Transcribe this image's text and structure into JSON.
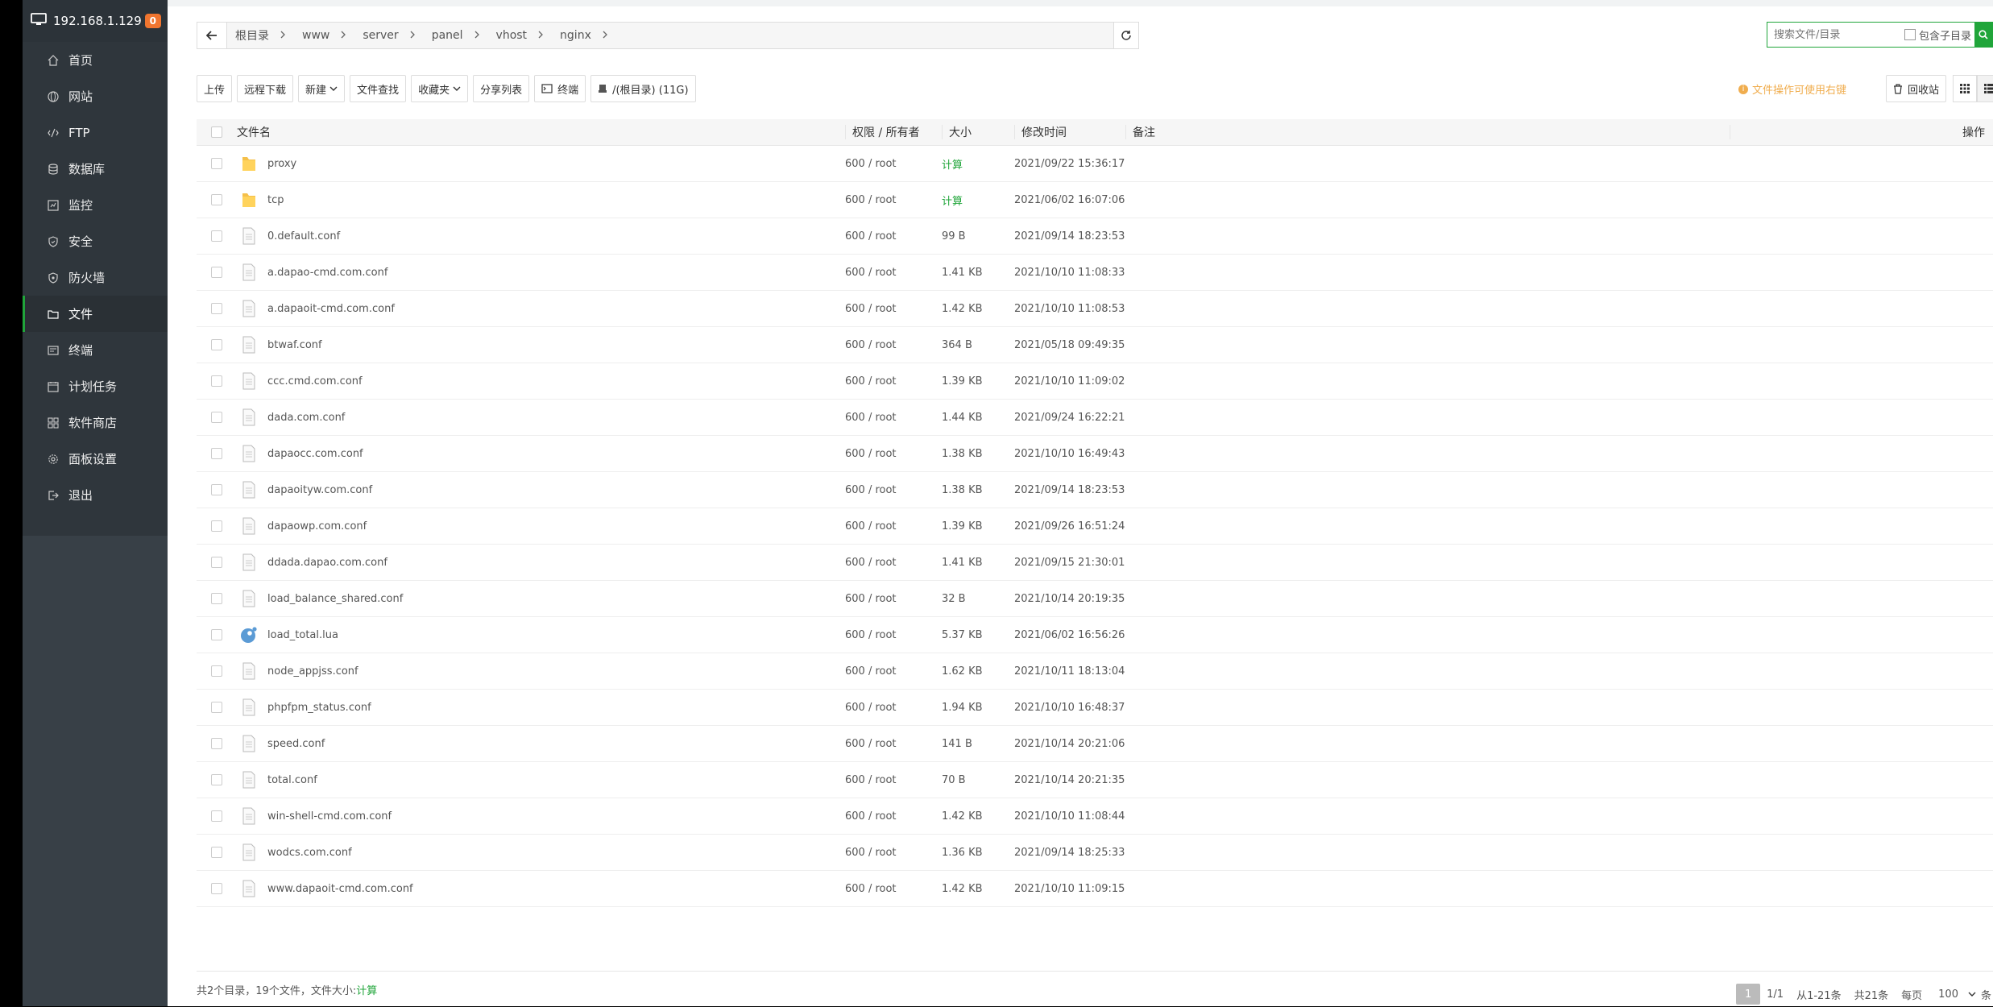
{
  "sidebar": {
    "host": "192.168.1.129",
    "badge": "0",
    "items": [
      {
        "label": "首页",
        "icon": "home-icon"
      },
      {
        "label": "网站",
        "icon": "globe-icon"
      },
      {
        "label": "FTP",
        "icon": "ftp-icon"
      },
      {
        "label": "数据库",
        "icon": "database-icon"
      },
      {
        "label": "监控",
        "icon": "monitor-icon"
      },
      {
        "label": "安全",
        "icon": "shield-icon"
      },
      {
        "label": "防火墙",
        "icon": "firewall-icon"
      },
      {
        "label": "文件",
        "icon": "folder-icon"
      },
      {
        "label": "终端",
        "icon": "terminal-icon"
      },
      {
        "label": "计划任务",
        "icon": "calendar-icon"
      },
      {
        "label": "软件商店",
        "icon": "apps-icon"
      },
      {
        "label": "面板设置",
        "icon": "gear-icon"
      },
      {
        "label": "退出",
        "icon": "logout-icon"
      }
    ],
    "active": "文件"
  },
  "breadcrumb": [
    "根目录",
    "www",
    "server",
    "panel",
    "vhost",
    "nginx"
  ],
  "search": {
    "placeholder": "搜索文件/目录",
    "subdir_label": "包含子目录"
  },
  "toolbar": {
    "upload": "上传",
    "remote_download": "远程下载",
    "new": "新建",
    "file_search": "文件查找",
    "favorites": "收藏夹",
    "share_list": "分享列表",
    "terminal": "终端",
    "disk": "/(根目录) (11G)",
    "tip": "文件操作可使用右键",
    "recycle": "回收站"
  },
  "table": {
    "headers": {
      "name": "文件名",
      "perm": "权限 / 所有者",
      "size": "大小",
      "time": "修改时间",
      "note": "备注",
      "op": "操作"
    },
    "rows": [
      {
        "type": "folder",
        "name": "proxy",
        "perm": "600 / root",
        "size": "计算",
        "time": "2021/09/22 15:36:17"
      },
      {
        "type": "folder",
        "name": "tcp",
        "perm": "600 / root",
        "size": "计算",
        "time": "2021/06/02 16:07:06"
      },
      {
        "type": "file",
        "name": "0.default.conf",
        "perm": "600 / root",
        "size": "99 B",
        "time": "2021/09/14 18:23:53"
      },
      {
        "type": "file",
        "name": "a.dapao-cmd.com.conf",
        "perm": "600 / root",
        "size": "1.41 KB",
        "time": "2021/10/10 11:08:33"
      },
      {
        "type": "file",
        "name": "a.dapaoit-cmd.com.conf",
        "perm": "600 / root",
        "size": "1.42 KB",
        "time": "2021/10/10 11:08:53"
      },
      {
        "type": "file",
        "name": "btwaf.conf",
        "perm": "600 / root",
        "size": "364 B",
        "time": "2021/05/18 09:49:35"
      },
      {
        "type": "file",
        "name": "ccc.cmd.com.conf",
        "perm": "600 / root",
        "size": "1.39 KB",
        "time": "2021/10/10 11:09:02"
      },
      {
        "type": "file",
        "name": "dada.com.conf",
        "perm": "600 / root",
        "size": "1.44 KB",
        "time": "2021/09/24 16:22:21"
      },
      {
        "type": "file",
        "name": "dapaocc.com.conf",
        "perm": "600 / root",
        "size": "1.38 KB",
        "time": "2021/10/10 16:49:43"
      },
      {
        "type": "file",
        "name": "dapaoityw.com.conf",
        "perm": "600 / root",
        "size": "1.38 KB",
        "time": "2021/09/14 18:23:53"
      },
      {
        "type": "file",
        "name": "dapaowp.com.conf",
        "perm": "600 / root",
        "size": "1.39 KB",
        "time": "2021/09/26 16:51:24"
      },
      {
        "type": "file",
        "name": "ddada.dapao.com.conf",
        "perm": "600 / root",
        "size": "1.41 KB",
        "time": "2021/09/15 21:30:01"
      },
      {
        "type": "file",
        "name": "load_balance_shared.conf",
        "perm": "600 / root",
        "size": "32 B",
        "time": "2021/10/14 20:19:35"
      },
      {
        "type": "lua",
        "name": "load_total.lua",
        "perm": "600 / root",
        "size": "5.37 KB",
        "time": "2021/06/02 16:56:26"
      },
      {
        "type": "file",
        "name": "node_appjss.conf",
        "perm": "600 / root",
        "size": "1.62 KB",
        "time": "2021/10/11 18:13:04"
      },
      {
        "type": "file",
        "name": "phpfpm_status.conf",
        "perm": "600 / root",
        "size": "1.94 KB",
        "time": "2021/10/10 16:48:37"
      },
      {
        "type": "file",
        "name": "speed.conf",
        "perm": "600 / root",
        "size": "141 B",
        "time": "2021/10/14 20:21:06"
      },
      {
        "type": "file",
        "name": "total.conf",
        "perm": "600 / root",
        "size": "70 B",
        "time": "2021/10/14 20:21:35"
      },
      {
        "type": "file",
        "name": "win-shell-cmd.com.conf",
        "perm": "600 / root",
        "size": "1.42 KB",
        "time": "2021/10/10 11:08:44"
      },
      {
        "type": "file",
        "name": "wodcs.com.conf",
        "perm": "600 / root",
        "size": "1.36 KB",
        "time": "2021/09/14 18:25:33"
      },
      {
        "type": "file",
        "name": "www.dapaoit-cmd.com.conf",
        "perm": "600 / root",
        "size": "1.42 KB",
        "time": "2021/10/10 11:09:15"
      }
    ]
  },
  "footer": {
    "summary": "共2个目录，19个文件，文件大小:",
    "calc": "计算",
    "pager": {
      "current": "1",
      "pages": "1/1",
      "range": "从1-21条",
      "total": "共21条",
      "per_page_label": "每页",
      "per_page": "100",
      "tail": "条"
    }
  },
  "colors": {
    "accent": "#20a53a",
    "sidebar_bg": "#384047",
    "badge": "#f0752f",
    "tip": "#f0ad4e"
  }
}
